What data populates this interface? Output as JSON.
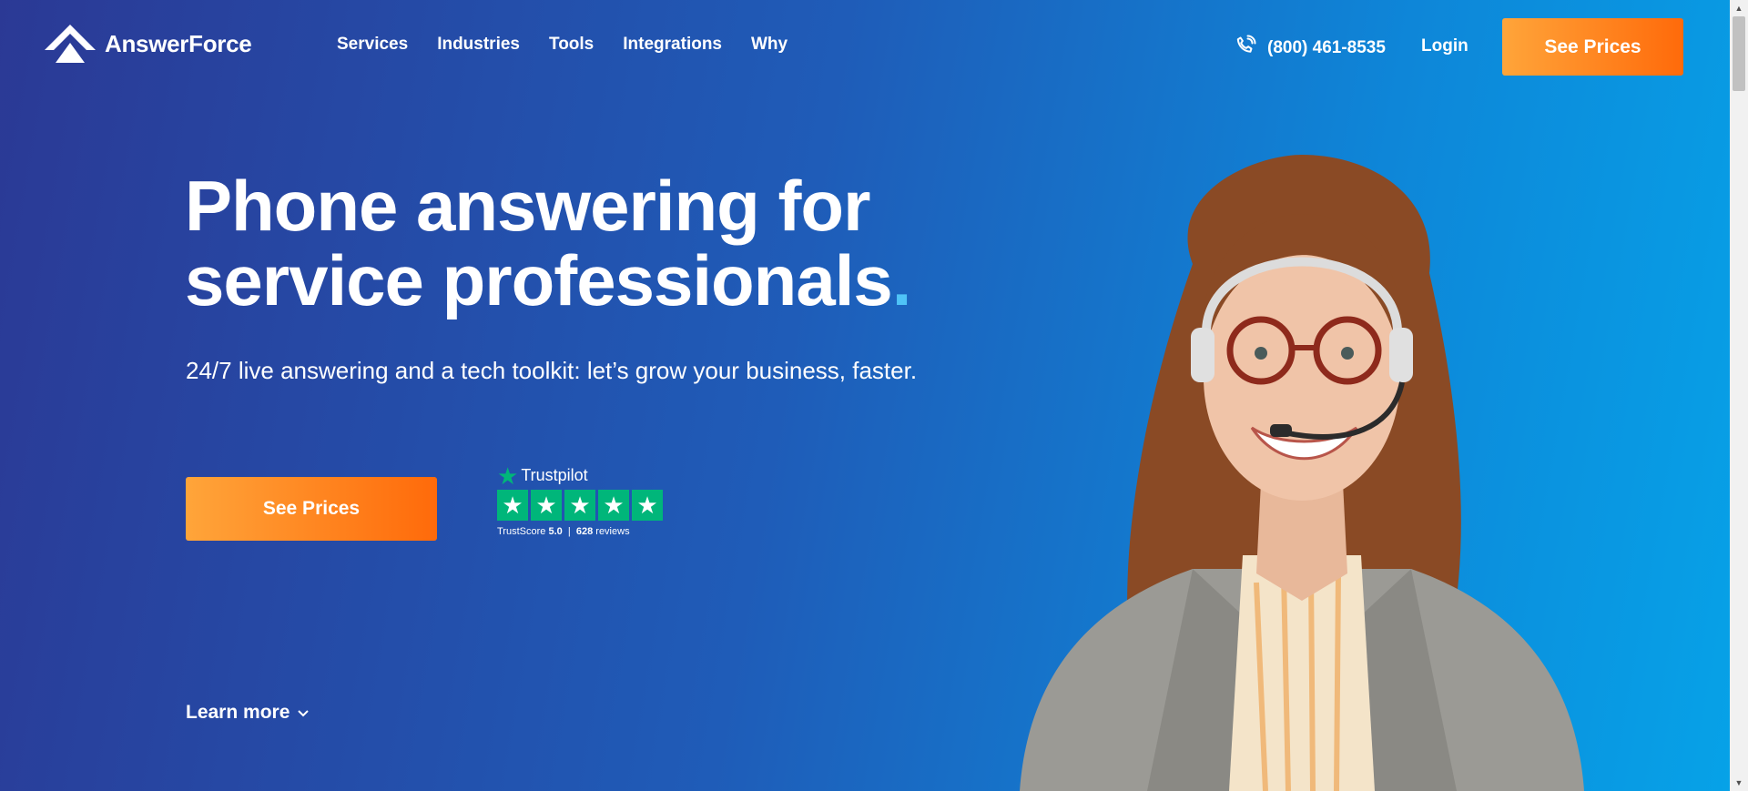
{
  "header": {
    "logo_text": "AnswerForce",
    "nav": [
      "Services",
      "Industries",
      "Tools",
      "Integrations",
      "Why"
    ],
    "phone": "(800) 461-8535",
    "login": "Login",
    "cta": "See Prices"
  },
  "hero": {
    "headline_line1": "Phone answering for",
    "headline_line2": "service professionals",
    "headline_dot": ".",
    "subhead": "24/7 live answering and a tech toolkit: let’s grow your business, faster.",
    "cta": "See Prices",
    "learn_more": "Learn more"
  },
  "trustpilot": {
    "brand": "Trustpilot",
    "stars": 5,
    "score_label": "TrustScore",
    "score": "5.0",
    "separator": "|",
    "reviews_count": "628",
    "reviews_label": "reviews"
  },
  "icons": {
    "logo": "answerforce-logo-icon",
    "phone": "phone-icon",
    "trustpilot_star": "trustpilot-star-icon",
    "chevron": "chevron-down-icon"
  },
  "colors": {
    "bg_start": "#2b3995",
    "bg_end": "#06a3e8",
    "cta_start": "#ffa53a",
    "cta_end": "#ff6a0a",
    "accent_dot": "#4fc3f7",
    "trustpilot_green": "#00b67a"
  }
}
